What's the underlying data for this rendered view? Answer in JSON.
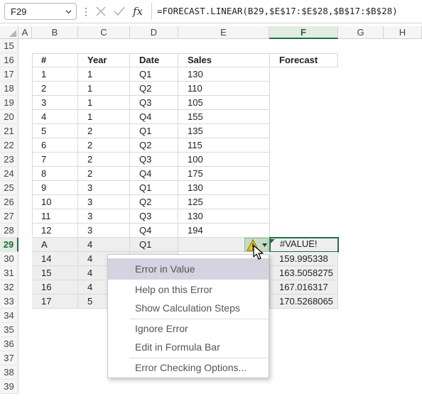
{
  "name_box": "F29",
  "formula": "=FORECAST.LINEAR(B29,$E$17:$E$28,$B$17:$B$28)",
  "fx_label": "fx",
  "columns": [
    "A",
    "B",
    "C",
    "D",
    "E",
    "F",
    "G",
    "H"
  ],
  "selected_column": "F",
  "rows": [
    "15",
    "16",
    "17",
    "18",
    "19",
    "20",
    "21",
    "22",
    "23",
    "24",
    "25",
    "26",
    "27",
    "28",
    "29",
    "30",
    "31",
    "32",
    "33",
    "34",
    "35",
    "36",
    "37",
    "38",
    "39"
  ],
  "selected_row": "29",
  "table": {
    "headers": {
      "num": "#",
      "year": "Year",
      "date": "Date",
      "sales": "Sales",
      "forecast": "Forecast"
    },
    "data_rows": [
      {
        "num": "1",
        "year": "1",
        "date": "Q1",
        "sales": "130"
      },
      {
        "num": "2",
        "year": "1",
        "date": "Q2",
        "sales": "110"
      },
      {
        "num": "3",
        "year": "1",
        "date": "Q3",
        "sales": "105"
      },
      {
        "num": "4",
        "year": "1",
        "date": "Q4",
        "sales": "155"
      },
      {
        "num": "5",
        "year": "2",
        "date": "Q1",
        "sales": "135"
      },
      {
        "num": "6",
        "year": "2",
        "date": "Q2",
        "sales": "115"
      },
      {
        "num": "7",
        "year": "2",
        "date": "Q3",
        "sales": "100"
      },
      {
        "num": "8",
        "year": "2",
        "date": "Q4",
        "sales": "175"
      },
      {
        "num": "9",
        "year": "3",
        "date": "Q1",
        "sales": "130"
      },
      {
        "num": "10",
        "year": "3",
        "date": "Q2",
        "sales": "125"
      },
      {
        "num": "11",
        "year": "3",
        "date": "Q3",
        "sales": "130"
      },
      {
        "num": "12",
        "year": "3",
        "date": "Q4",
        "sales": "194"
      }
    ],
    "forecast_rows": [
      {
        "num": "A",
        "year": "4",
        "date": "Q1",
        "forecast": "#VALUE!"
      },
      {
        "num": "14",
        "year": "4",
        "date": "",
        "forecast": "159.995338"
      },
      {
        "num": "15",
        "year": "4",
        "date": "",
        "forecast": "163.5058275"
      },
      {
        "num": "16",
        "year": "4",
        "date": "",
        "forecast": "167.016317"
      },
      {
        "num": "17",
        "year": "5",
        "date": "",
        "forecast": "170.5268065"
      }
    ]
  },
  "error_menu": {
    "title": "Error in Value",
    "items": [
      "Help on this Error",
      "Show Calculation Steps",
      "Ignore Error",
      "Edit in Formula Bar",
      "Error Checking Options..."
    ]
  },
  "colors": {
    "accent_green": "#1e7145",
    "error_indicator": "#1e7145",
    "warning_yellow": "#f5c518",
    "menu_highlight": "#d4d3e0",
    "forecast_fill": "#eeeeee"
  }
}
